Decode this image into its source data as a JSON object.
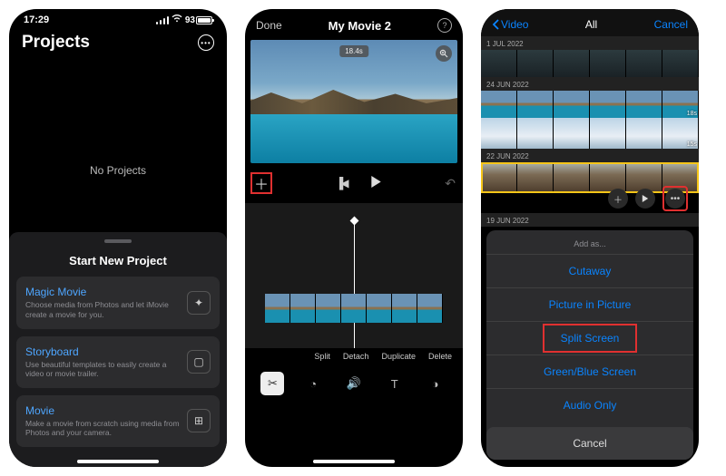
{
  "phone1": {
    "status": {
      "time": "17:29",
      "battery_pct": "93"
    },
    "header_title": "Projects",
    "empty_text": "No Projects",
    "sheet_title": "Start New Project",
    "cards": [
      {
        "title": "Magic Movie",
        "sub": "Choose media from Photos and let iMovie create a movie for you.",
        "icon": "✦"
      },
      {
        "title": "Storyboard",
        "sub": "Use beautiful templates to easily create a video or movie trailer.",
        "icon": "▢"
      },
      {
        "title": "Movie",
        "sub": "Make a movie from scratch using media from Photos and your camera.",
        "icon": "⊞"
      }
    ]
  },
  "phone2": {
    "done": "Done",
    "title": "My Movie 2",
    "preview_time": "18.4s",
    "actions": [
      "Split",
      "Detach",
      "Duplicate",
      "Delete"
    ]
  },
  "phone3": {
    "back": "Video",
    "tab": "All",
    "cancel": "Cancel",
    "sections": [
      {
        "label": "1 JUL 2022"
      },
      {
        "label": "24 JUN 2022",
        "durations": [
          "18s",
          "15s"
        ]
      },
      {
        "label": "22 JUN 2022"
      },
      {
        "label": "19 JUN 2022"
      }
    ],
    "sheet_hdr": "Add as...",
    "options": [
      "Cutaway",
      "Picture in Picture",
      "Split Screen",
      "Green/Blue Screen",
      "Audio Only"
    ],
    "cancel_opt": "Cancel"
  }
}
